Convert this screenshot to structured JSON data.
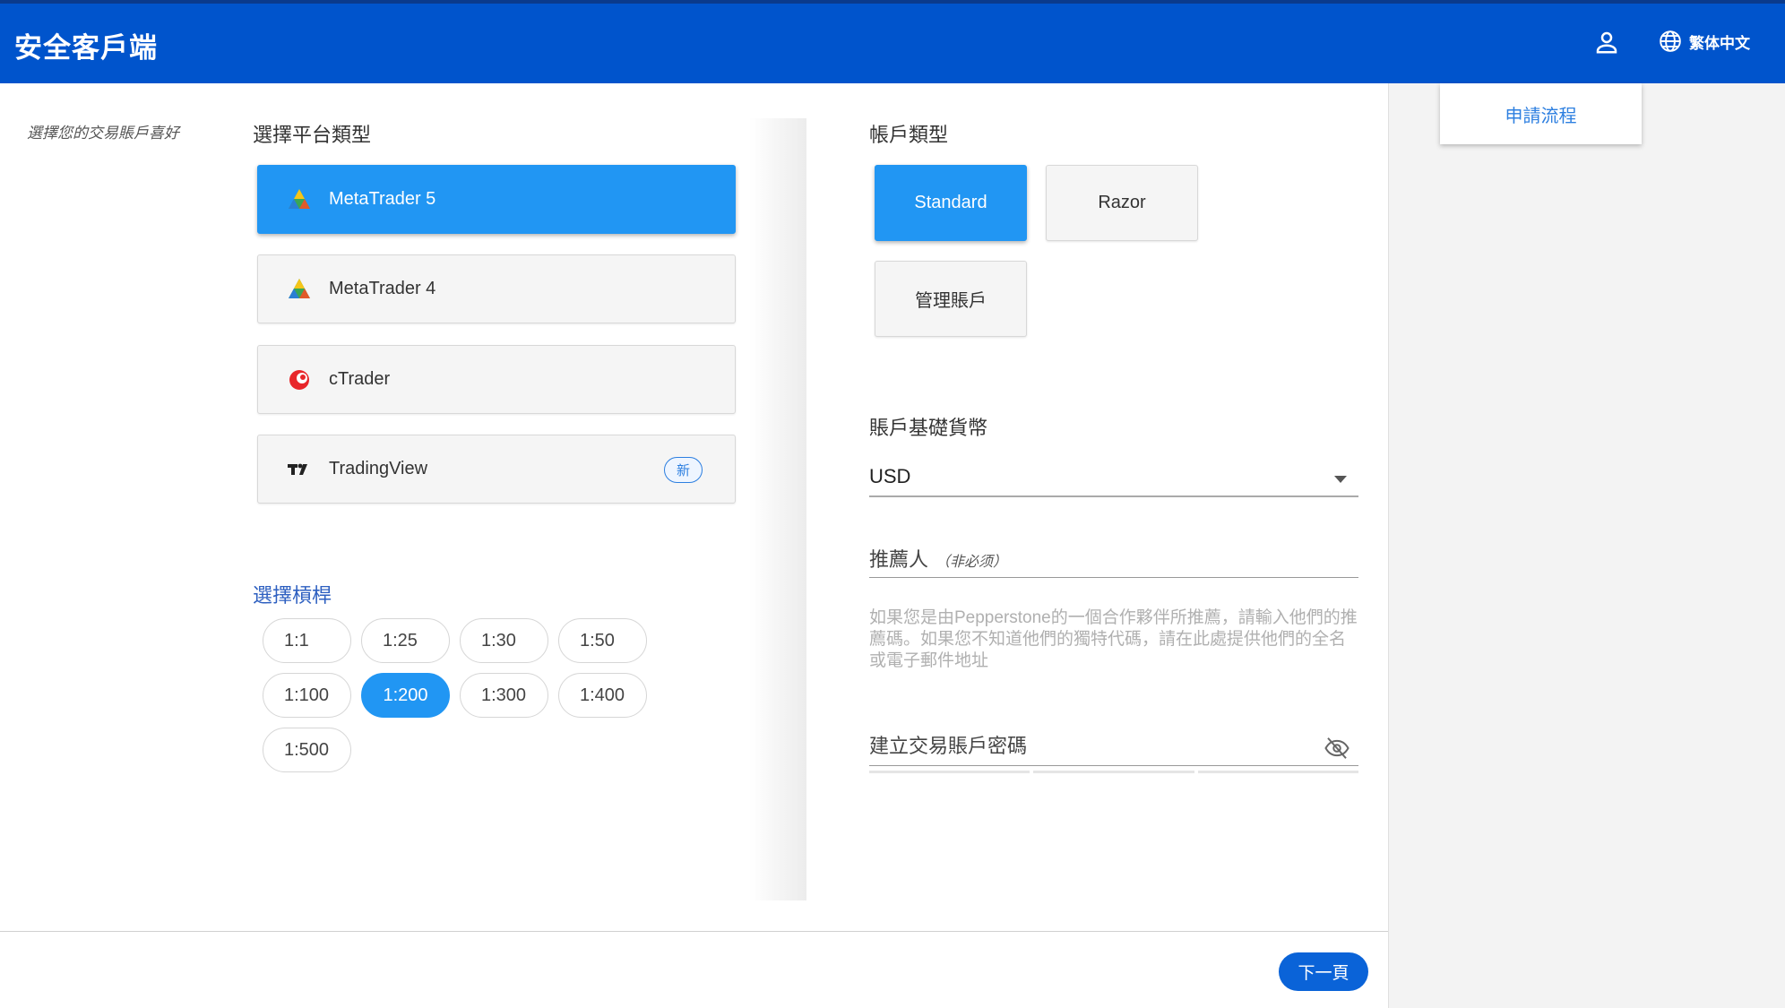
{
  "header": {
    "brand": "安全客戶端",
    "language": "繁体中文",
    "icons": {
      "user": "user-icon",
      "globe": "globe-icon"
    }
  },
  "right_panel": {
    "process_tab": "申請流程"
  },
  "step_label": "選擇您的交易賬戶喜好",
  "platform_section": {
    "title": "選擇平台類型",
    "items": [
      {
        "label": "MetaTrader 5",
        "icon": "metatrader5-icon",
        "selected": true
      },
      {
        "label": "MetaTrader 4",
        "icon": "metatrader4-icon",
        "selected": false
      },
      {
        "label": "cTrader",
        "icon": "ctrader-icon",
        "selected": false
      },
      {
        "label": "TradingView",
        "icon": "tradingview-icon",
        "selected": false,
        "badge": "新"
      }
    ]
  },
  "leverage_section": {
    "title": "選擇槓桿",
    "options": [
      "1:1",
      "1:25",
      "1:30",
      "1:50",
      "1:100",
      "1:200",
      "1:300",
      "1:400",
      "1:500"
    ],
    "selected": "1:200"
  },
  "account_type_section": {
    "title": "帳戶類型",
    "options": [
      "Standard",
      "Razor",
      "管理賬戶"
    ],
    "selected": "Standard"
  },
  "currency_section": {
    "title": "賬戶基礎貨幣",
    "value": "USD"
  },
  "referrer": {
    "label": "推薦人",
    "optional": "（非必须）",
    "helper": "如果您是由Pepperstone的一個合作夥伴所推薦，請輸入他們的推薦碼。如果您不知道他們的獨特代碼，請在此處提供他們的全名或電子郵件地址"
  },
  "password": {
    "label": "建立交易賬戶密碼",
    "icon": "eye-off-icon"
  },
  "footer": {
    "next_label": "下一頁"
  },
  "colors": {
    "header": "#0054cc",
    "accent": "#2196f3",
    "next_button": "#0a63d8"
  }
}
